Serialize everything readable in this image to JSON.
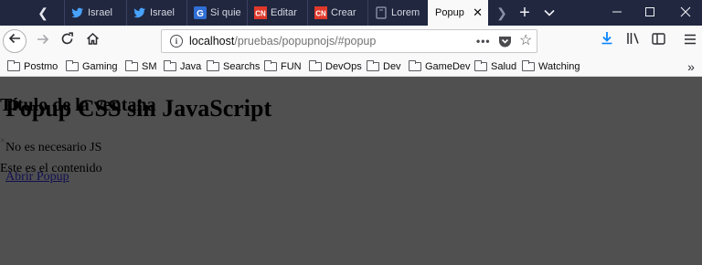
{
  "browser": {
    "tabs": [
      {
        "label": "Israel",
        "icon": "twitter-icon",
        "active": false
      },
      {
        "label": "Israel",
        "icon": "twitter-icon",
        "active": false
      },
      {
        "label": "Si quie",
        "icon": "g-icon",
        "active": false
      },
      {
        "label": "Editar",
        "icon": "cn-icon",
        "active": false
      },
      {
        "label": "Crear",
        "icon": "cn-icon",
        "active": false
      },
      {
        "label": "Lorem",
        "icon": "lorem-icon",
        "active": false
      },
      {
        "label": "Popup",
        "icon": "",
        "active": true
      }
    ],
    "url": {
      "host": "localhost",
      "path": "/pruebas/popupnojs/#popup"
    },
    "bookmarks": [
      "Postmo",
      "Gaming",
      "SM",
      "Java",
      "Searchs",
      "FUN",
      "DevOps",
      "Dev",
      "GameDev",
      "Salud",
      "Watching"
    ],
    "colors": {
      "tab_strip": "#20273f",
      "toolbar": "#f9f9fa",
      "accent_download": "#0a84ff",
      "page_overlay": "#505050"
    }
  },
  "page": {
    "heading": "Popup CSS sin JavaScript",
    "intro": "No es necesario JS",
    "open_link": "Abrir Popup",
    "popup": {
      "title": "Título de la ventana",
      "close": "×",
      "content": "Este es el contenido"
    }
  }
}
